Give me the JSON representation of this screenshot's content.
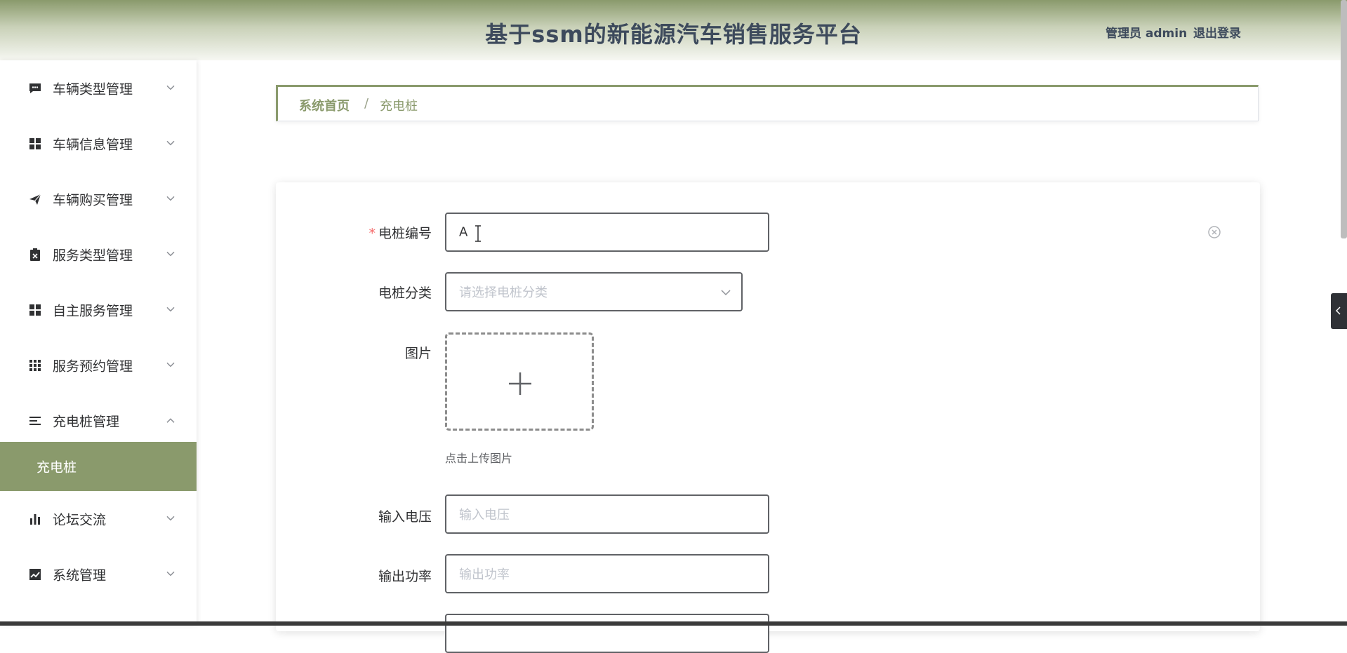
{
  "header": {
    "title": "基于ssm的新能源汽车销售服务平台",
    "user": "管理员 admin",
    "logout": "退出登录"
  },
  "sidebar": {
    "items": [
      {
        "label": "车辆类型管理",
        "icon": "chat-icon"
      },
      {
        "label": "车辆信息管理",
        "icon": "grid-icon"
      },
      {
        "label": "车辆购买管理",
        "icon": "send-icon"
      },
      {
        "label": "服务类型管理",
        "icon": "clipboard-icon"
      },
      {
        "label": "自主服务管理",
        "icon": "grid-icon"
      },
      {
        "label": "服务预约管理",
        "icon": "apps-icon"
      },
      {
        "label": "充电桩管理",
        "icon": "list-icon"
      },
      {
        "label": "论坛交流",
        "icon": "bar-chart-icon"
      },
      {
        "label": "系统管理",
        "icon": "line-chart-icon"
      }
    ],
    "active_sub": "充电桩"
  },
  "breadcrumb": {
    "home": "系统首页",
    "separator": "/",
    "current": "充电桩"
  },
  "form": {
    "pile_no": {
      "label": "电桩编号",
      "value": "A"
    },
    "category": {
      "label": "电桩分类",
      "placeholder": "请选择电桩分类"
    },
    "image": {
      "label": "图片",
      "hint": "点击上传图片"
    },
    "input_voltage": {
      "label": "输入电压",
      "placeholder": "输入电压"
    },
    "output_power": {
      "label": "输出功率",
      "placeholder": "输出功率"
    }
  },
  "colors": {
    "accent": "#8a9a6c",
    "required": "#f56c6c"
  }
}
